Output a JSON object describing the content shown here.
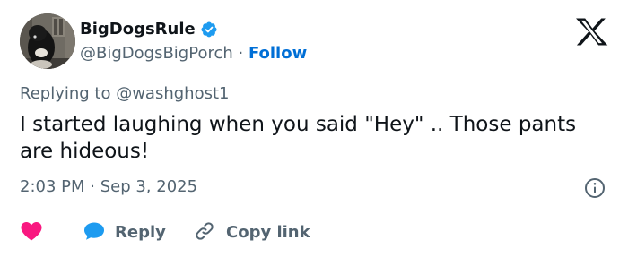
{
  "author": {
    "display_name": "BigDogsRule",
    "handle": "@BigDogsBigPorch",
    "separator": " · ",
    "follow_label": "Follow"
  },
  "tweet": {
    "replying_to_label": "Replying to ",
    "replying_to_handle": "@washghost1",
    "text": "I started laughing when you said \"Hey\" .. Those pants are hideous!",
    "timestamp": "2:03 PM · Sep 3, 2025"
  },
  "actions": {
    "like_icon": "heart-icon",
    "reply_icon": "speech-bubble-icon",
    "reply_label": "Reply",
    "copy_icon": "link-icon",
    "copy_label": "Copy link"
  },
  "icons": {
    "verified": "verified-badge-icon",
    "brand": "x-logo-icon",
    "info": "info-icon"
  },
  "colors": {
    "text": "#0f1419",
    "secondary": "#536471",
    "link": "#006fd6",
    "verified": "#1d9bf0",
    "like": "#f91880",
    "reply": "#1d9bf0",
    "divider": "#cfd9de"
  }
}
